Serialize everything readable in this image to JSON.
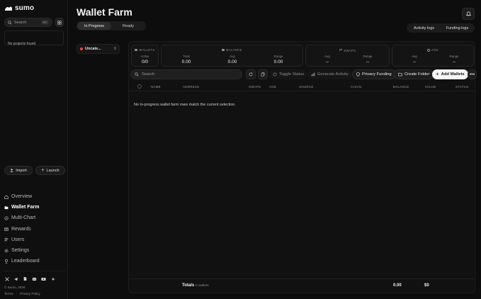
{
  "brand": {
    "name": "sumo"
  },
  "sidebar": {
    "search_placeholder": "Search",
    "search_shortcut": "⌘K",
    "projects_empty": "No projects found",
    "import_label": "Import",
    "launch_label": "Launch",
    "nav": [
      {
        "label": "Overview",
        "icon": "home-icon",
        "active": false
      },
      {
        "label": "Wallet Farm",
        "icon": "folder-icon",
        "active": true
      },
      {
        "label": "Multi-Chart",
        "icon": "multi-chart-icon",
        "active": false
      },
      {
        "label": "Rewards",
        "icon": "rewards-icon",
        "active": false
      },
      {
        "label": "Users",
        "icon": "users-icon",
        "active": false
      },
      {
        "label": "Settings",
        "icon": "gear-icon",
        "active": false
      },
      {
        "label": "Leaderboard",
        "icon": "trophy-icon",
        "active": false
      }
    ],
    "socials": [
      "x-icon",
      "telegram-icon",
      "docs-icon",
      "discord-icon",
      "youtube-icon",
      "sparkle-icon"
    ],
    "copyright": "© Sumo, 2026",
    "links": [
      "Terms",
      "·",
      "Privacy Policy"
    ]
  },
  "header": {
    "title": "Wallet Farm",
    "tabs": [
      {
        "label": "In Progress",
        "active": true
      },
      {
        "label": "Ready",
        "active": false
      }
    ],
    "log_tabs": [
      {
        "label": "Activity logs"
      },
      {
        "label": "Funding logs"
      }
    ]
  },
  "folder": {
    "name": "Uncate...",
    "count": "0"
  },
  "stats": {
    "wallets": {
      "title": "WALLETS",
      "cols": [
        {
          "label": "Active",
          "value": "0/0"
        }
      ]
    },
    "balance": {
      "title": "BALANCE",
      "cols": [
        {
          "label": "Total",
          "value": "0.00"
        },
        {
          "label": "Avg",
          "value": "0.00"
        },
        {
          "label": "Range",
          "value": "0.00"
        }
      ]
    },
    "swaps": {
      "title": "SWAPS",
      "cols": [
        {
          "label": "Avg",
          "value": "--"
        },
        {
          "label": "Range",
          "value": "--"
        }
      ]
    },
    "age": {
      "title": "AGE",
      "cols": [
        {
          "label": "Avg",
          "value": "--"
        },
        {
          "label": "Range",
          "value": "--"
        }
      ]
    }
  },
  "toolbar": {
    "search_placeholder": "Search",
    "toggle_status": "Toggle Status",
    "generate_activity": "Generate Activity",
    "privacy_funding": "Privacy Funding",
    "create_folder": "Create Folder",
    "add_wallets": "Add Wallets"
  },
  "table": {
    "headers": [
      "NAME",
      "ADDRESS",
      "SWAPS",
      "AGE",
      "SOURCE",
      "CHAIN",
      "BALANCE",
      "VALUE",
      "STATUS"
    ],
    "empty_message": "No In-progress wallet farm rows match the current selection."
  },
  "totals": {
    "label": "Totals",
    "wallets": "0 wallets",
    "balance": "0.00",
    "value": "$0"
  }
}
